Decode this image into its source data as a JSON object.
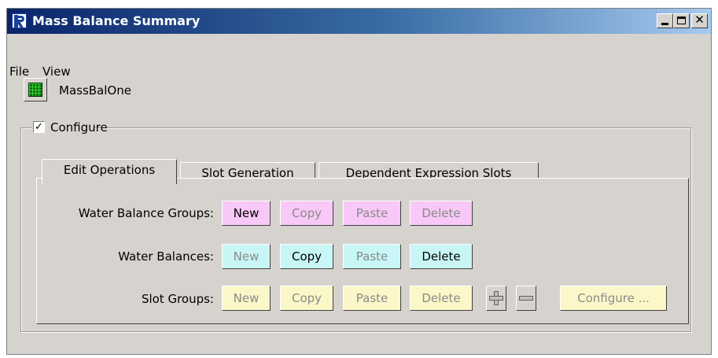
{
  "window": {
    "title": "Mass Balance Summary",
    "controls": {
      "minimize": "_",
      "maximize": "□",
      "close": "✕"
    }
  },
  "menu": {
    "file": "File",
    "view": "View"
  },
  "object": {
    "name": "MassBalOne",
    "icon": "grid-icon"
  },
  "configure": {
    "label": "Configure",
    "checked": true,
    "check_glyph": "✓"
  },
  "tabs": [
    {
      "label": "Edit Operations",
      "active": true
    },
    {
      "label": "Slot Generation",
      "active": false
    },
    {
      "label": "Dependent Expression Slots",
      "active": false
    }
  ],
  "rows": {
    "water_balance_groups": {
      "label": "Water Balance Groups:",
      "new": "New",
      "copy": "Copy",
      "paste": "Paste",
      "delete": "Delete"
    },
    "water_balances": {
      "label": "Water Balances:",
      "new": "New",
      "copy": "Copy",
      "paste": "Paste",
      "delete": "Delete"
    },
    "slot_groups": {
      "label": "Slot Groups:",
      "new": "New",
      "copy": "Copy",
      "paste": "Paste",
      "delete": "Delete",
      "configure": "Configure ..."
    }
  },
  "colors": {
    "pink": "#f8c8f6",
    "cyan": "#c8f6f6",
    "yellow": "#fbf7c8",
    "titlebar": "#0a246a"
  }
}
